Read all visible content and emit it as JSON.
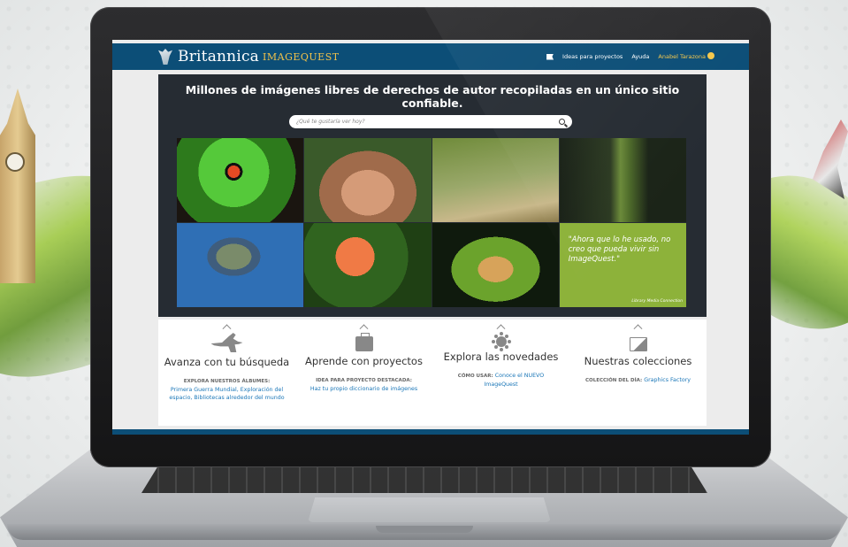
{
  "colors": {
    "header_bg": "#0c4e77",
    "hero_bg": "#262c33",
    "accent_gold": "#f2c24a",
    "link_blue": "#1b77b8",
    "quote_green": "#8db23a"
  },
  "header": {
    "brand_name": "Britannica",
    "brand_product": "IMAGEQUEST",
    "nav_ideas": "Ideas para proyectos",
    "nav_help": "Ayuda",
    "nav_user": "Anabel Tarazona"
  },
  "hero": {
    "title": "Millones de imágenes libres de derechos de autor recopiladas en un único sitio confiable.",
    "search_placeholder": "¿Qué te gustaría ver hoy?",
    "quote": "\"Ahora que lo he usado, no creo que pueda vivir sin ImageQuest.\"",
    "quote_source": "Library Media Connection"
  },
  "features": [
    {
      "icon": "kangaroo-icon",
      "title": "Avanza con tu búsqueda",
      "label": "EXPLORA NUESTROS ÁLBUMES:",
      "text": "Primera Guerra Mundial, Exploración del espacio, Bibliotecas alrededor del mundo"
    },
    {
      "icon": "briefcase-icon",
      "title": "Aprende con proyectos",
      "label": "IDEA PARA PROYECTO DESTACADA:",
      "text": "Haz tu propio diccionario de imágenes"
    },
    {
      "icon": "sun-icon",
      "title": "Explora las novedades",
      "label": "CÓMO USAR:",
      "text": "Conoce el NUEVO ImageQuest"
    },
    {
      "icon": "image-icon",
      "title": "Nuestras colecciones",
      "label": "COLECCIÓN DEL DÍA:",
      "text": "Graphics Factory"
    }
  ]
}
